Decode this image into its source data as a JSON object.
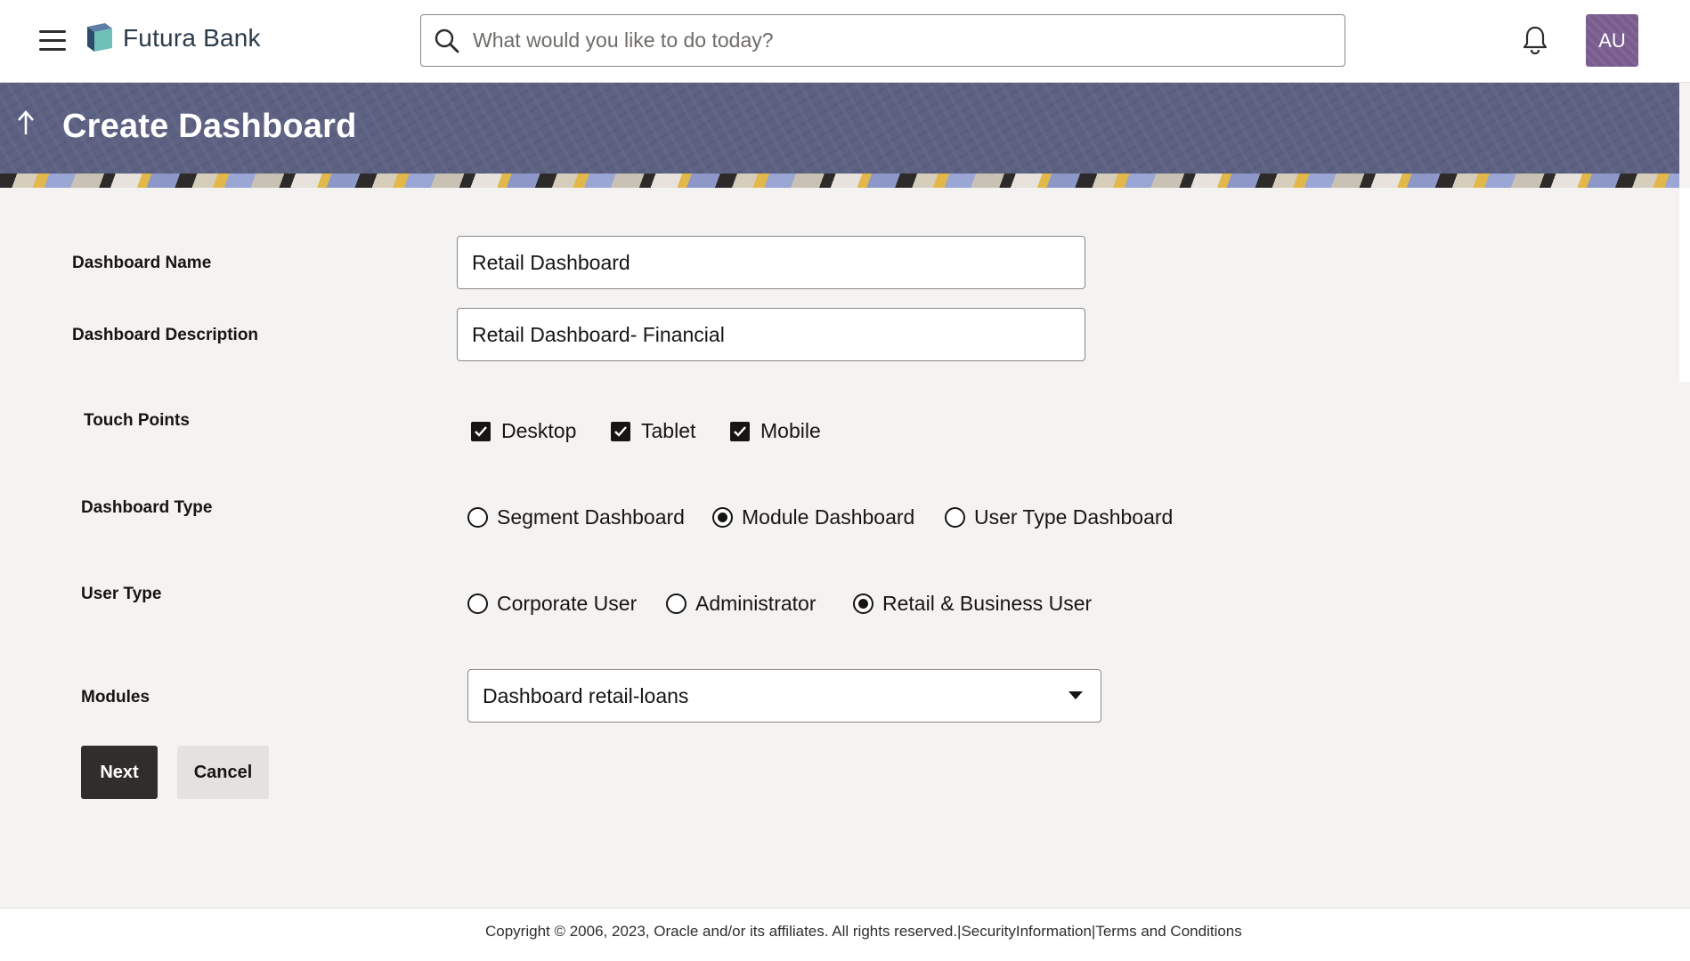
{
  "header": {
    "brand": "Futura Bank",
    "search_placeholder": "What would you like to do today?",
    "avatar_initials": "AU",
    "avatar_color": "#7a5d8f"
  },
  "banner": {
    "title": "Create Dashboard",
    "background_color": "#5d6182"
  },
  "form": {
    "dashboard_name": {
      "label": "Dashboard Name",
      "value": "Retail Dashboard"
    },
    "dashboard_description": {
      "label": "Dashboard Description",
      "value": "Retail Dashboard- Financial"
    },
    "touch_points": {
      "label": "Touch Points",
      "options": [
        {
          "label": "Desktop",
          "checked": true
        },
        {
          "label": "Tablet",
          "checked": true
        },
        {
          "label": "Mobile",
          "checked": true
        }
      ]
    },
    "dashboard_type": {
      "label": "Dashboard Type",
      "options": [
        {
          "label": "Segment Dashboard",
          "selected": false
        },
        {
          "label": "Module Dashboard",
          "selected": true
        },
        {
          "label": "User Type Dashboard",
          "selected": false
        }
      ]
    },
    "user_type": {
      "label": "User Type",
      "options": [
        {
          "label": "Corporate User",
          "selected": false
        },
        {
          "label": "Administrator",
          "selected": false
        },
        {
          "label": "Retail & Business User",
          "selected": true
        }
      ]
    },
    "modules": {
      "label": "Modules",
      "selected": "Dashboard retail-loans"
    }
  },
  "actions": {
    "next_label": "Next",
    "cancel_label": "Cancel",
    "primary_color": "#312d2a"
  },
  "footer": {
    "copyright": "Copyright © 2006, 2023, Oracle and/or its affiliates. All rights reserved.",
    "separator": "|",
    "security_link": "SecurityInformation",
    "terms_link": "Terms and Conditions"
  }
}
